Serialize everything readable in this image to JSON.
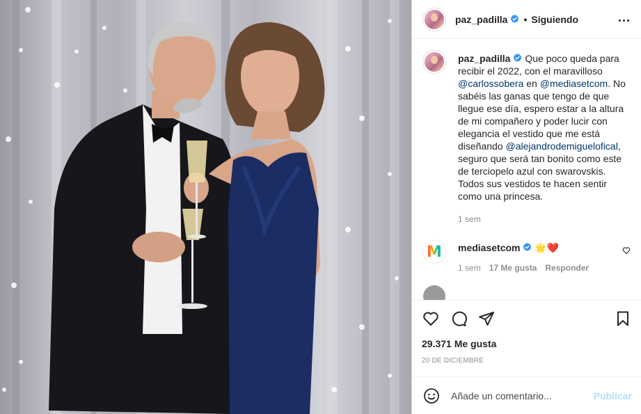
{
  "post": {
    "username": "paz_padilla",
    "follow_status": "Siguiendo",
    "separator": "•",
    "caption": {
      "username": "paz_padilla",
      "text_1": " Que poco queda para recibir el 2022, con el maravilloso ",
      "mention_1": "@carlossobera",
      "text_2": " en ",
      "mention_2": "@mediasetcom",
      "text_3": ". No sabéis las ganas que tengo de que llegue ese día, espero estar a la altura de mi compañero y poder lucir con elegancia el vestido que me está diseñando ",
      "mention_3": "@alejandrodemiguelofical",
      "text_4": ", seguro que será tan bonito como este de terciopelo azul con swarovskis. Todos sus vestidos te hacen sentir como una princesa.",
      "time": "1 sem"
    },
    "comments": [
      {
        "username": "mediasetcom",
        "text": " 🌟❤️",
        "avatar_letter": "M",
        "time": "1 sem",
        "likes": "17 Me gusta",
        "reply": "Responder"
      }
    ],
    "likes_count": "29.371 Me gusta",
    "date": "20 DE DICIEMBRE",
    "comment_placeholder": "Añade un comentario...",
    "publish_label": "Publicar"
  },
  "icons": {
    "more": "more-options-icon",
    "verified": "verified-badge-icon",
    "like": "heart-icon",
    "comment": "comment-bubble-icon",
    "share": "paper-plane-icon",
    "save": "bookmark-icon",
    "emoji": "emoji-smiley-icon"
  },
  "colors": {
    "link": "#00376b",
    "verified": "#3897f0",
    "publish_disabled": "#b2dffc",
    "muted": "#8e8e8e"
  }
}
